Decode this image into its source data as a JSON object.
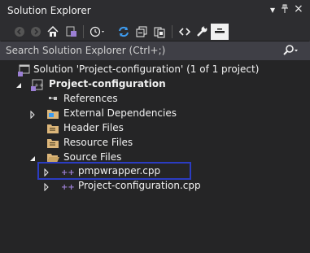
{
  "window": {
    "title": "Solution Explorer",
    "menu_glyph": "▾",
    "pin_glyph": "ᚆ",
    "close_glyph": "×"
  },
  "search": {
    "placeholder": "Search Solution Explorer (Ctrl+;)",
    "value": ""
  },
  "tree": {
    "solution": "Solution 'Project-configuration' (1 of 1 project)",
    "project": "Project-configuration",
    "references": "References",
    "external_dependencies": "External Dependencies",
    "header_files": "Header Files",
    "resource_files": "Resource Files",
    "source_files": "Source Files",
    "file1": "pmpwrapper.cpp",
    "file2": "Project-configuration.cpp"
  },
  "colors": {
    "highlight_box": "#2b3cc2",
    "folder": "#dcb67a",
    "cpp": "#9b7fd4"
  }
}
